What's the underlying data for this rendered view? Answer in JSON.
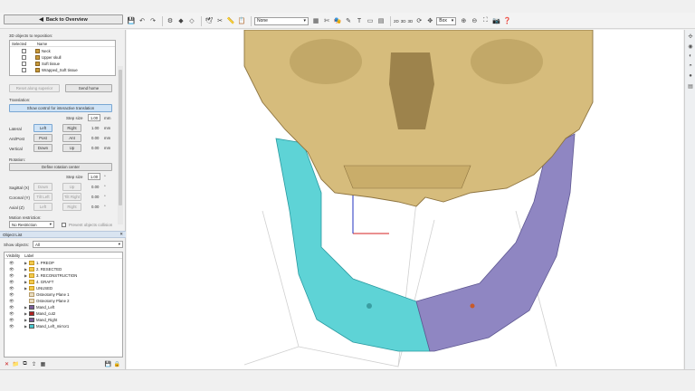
{
  "header": {
    "back_label": "Back to Overview"
  },
  "toolbar": {
    "view_select": "None",
    "zoom_items": [
      "2D",
      "3D",
      "3D"
    ],
    "mode_select": "Box"
  },
  "reposition": {
    "title": "3D objects to reposition:",
    "col_selected": "Selected",
    "col_name": "Name",
    "objects": [
      "Neck",
      "Upper skull",
      "Soft tissue",
      "Wrapped_Soft tissue"
    ],
    "reset_label": "Reset along superior",
    "send_home_label": "Send home"
  },
  "translation": {
    "title": "Translation:",
    "show_control_label": "Show control for interactive translation",
    "step_size_label": "Step size",
    "step_size": "1.00",
    "unit": "mm",
    "rows": [
      {
        "label": "Lateral",
        "a": "Left",
        "b": "Right",
        "value": "1.00"
      },
      {
        "label": "Ant/Post",
        "a": "Post",
        "b": "Ant",
        "value": "0.00"
      },
      {
        "label": "Vertical",
        "a": "Down",
        "b": "Up",
        "value": "0.00"
      }
    ]
  },
  "rotation": {
    "title": "Rotation:",
    "define_center_label": "Define rotation center",
    "step_size_label": "Step size",
    "step_size": "1.00",
    "unit": "°",
    "rows": [
      {
        "label": "Sagittal (X)",
        "a": "Down",
        "b": "Up",
        "value": "0.00"
      },
      {
        "label": "Coronal (Y)",
        "a": "Tilt Left",
        "b": "Tilt Right",
        "value": "0.00"
      },
      {
        "label": "Axial (Z)",
        "a": "Left",
        "b": "Right",
        "value": "0.00"
      }
    ]
  },
  "motion": {
    "title": "Motion restriction:",
    "restriction_value": "No Restriction",
    "prevent_collision_label": "Prevent objects collision"
  },
  "object_list": {
    "title": "Object List",
    "show_objects_label": "Show objects:",
    "show_objects_value": "All",
    "col_visibility": "Visibility",
    "col_label": "Label",
    "items": [
      {
        "label": "1. PREOP",
        "kind": "folder"
      },
      {
        "label": "2. RESECTED",
        "kind": "folder"
      },
      {
        "label": "3. RECONSTRUCTION",
        "kind": "folder"
      },
      {
        "label": "4. GRAFT",
        "kind": "folder"
      },
      {
        "label": "UNUSED",
        "kind": "folder"
      },
      {
        "label": "Osteotomy Plane 1",
        "kind": "plane"
      },
      {
        "label": "Osteotomy Plane 2",
        "kind": "plane"
      },
      {
        "label": "Mand_Left",
        "kind": "obj",
        "color": "#7a5a9a"
      },
      {
        "label": "Mand_cut2",
        "kind": "obj",
        "color": "#b02020"
      },
      {
        "label": "Mand_Right",
        "kind": "obj",
        "color": "#7a5a9a"
      },
      {
        "label": "Mand_Left_mirror1",
        "kind": "obj",
        "color": "#46c8d0"
      }
    ]
  },
  "colors": {
    "bone": "#d6bc7c",
    "bone_shadow": "#8e7440",
    "graft_left": "#5ed3d6",
    "graft_right": "#8f86c2",
    "accent": "#cfe3f6"
  }
}
